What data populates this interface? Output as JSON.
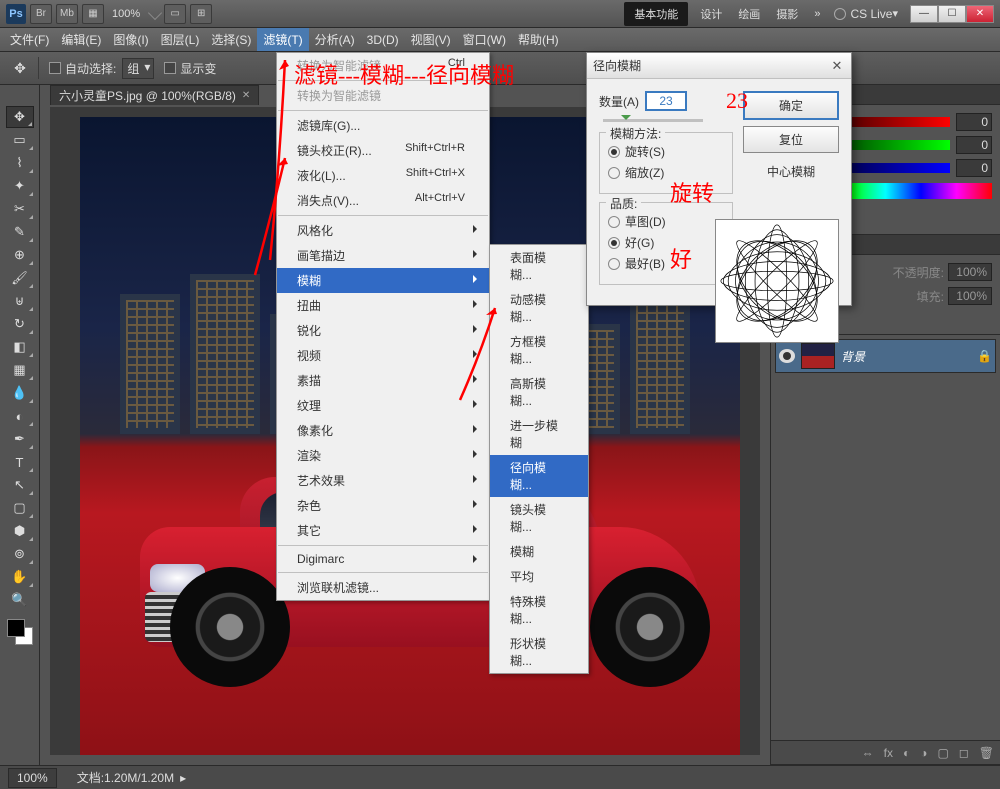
{
  "titlebar": {
    "zoom": "100%",
    "workspace_active": "基本功能",
    "workspace_items": [
      "设计",
      "绘画",
      "摄影"
    ],
    "more": "»",
    "cslive": "CS Live",
    "icons": [
      "Br",
      "Mb"
    ]
  },
  "menubar": {
    "items": [
      "文件(F)",
      "编辑(E)",
      "图像(I)",
      "图层(L)",
      "选择(S)",
      "滤镜(T)",
      "分析(A)",
      "3D(D)",
      "视图(V)",
      "窗口(W)",
      "帮助(H)"
    ],
    "active_index": 5
  },
  "optbar": {
    "auto_select": "自动选择:",
    "group": "组",
    "show_transform": "显示变"
  },
  "document": {
    "tab": "六小灵童PS.jpg @ 100%(RGB/8)",
    "status_zoom": "100%",
    "status_doc": "文档:1.20M/1.20M"
  },
  "filter_menu": {
    "last": "转换为智能滤镜",
    "last_shortcut": "Ctrl",
    "items1": [
      {
        "label": "滤镜库(G)...",
        "shortcut": ""
      },
      {
        "label": "镜头校正(R)...",
        "shortcut": "Shift+Ctrl+R"
      },
      {
        "label": "液化(L)...",
        "shortcut": "Shift+Ctrl+X"
      },
      {
        "label": "消失点(V)...",
        "shortcut": "Alt+Ctrl+V"
      }
    ],
    "items2": [
      "风格化",
      "画笔描边",
      "模糊",
      "扭曲",
      "锐化",
      "视频",
      "素描",
      "纹理",
      "像素化",
      "渲染",
      "艺术效果",
      "杂色",
      "其它"
    ],
    "hl_index": 2,
    "digimarc": "Digimarc",
    "browse": "浏览联机滤镜..."
  },
  "blur_submenu": {
    "items": [
      "表面模糊...",
      "动感模糊...",
      "方框模糊...",
      "高斯模糊...",
      "进一步模糊",
      "径向模糊...",
      "镜头模糊...",
      "模糊",
      "平均",
      "特殊模糊...",
      "形状模糊..."
    ],
    "hl_index": 5
  },
  "dialog": {
    "title": "径向模糊",
    "amount_label": "数量(A)",
    "amount_value": "23",
    "ok": "确定",
    "cancel": "复位",
    "method_legend": "模糊方法:",
    "method_spin": "旋转(S)",
    "method_zoom": "缩放(Z)",
    "quality_legend": "品质:",
    "quality_draft": "草图(D)",
    "quality_good": "好(G)",
    "quality_best": "最好(B)",
    "preview_label": "中心模糊"
  },
  "panels": {
    "color": {
      "r": "0",
      "g": "0",
      "b": "0"
    },
    "layers": {
      "opacity_label": "不透明度:",
      "opacity": "100%",
      "fill_label": "填充:",
      "fill": "100%",
      "layer_name": "背景"
    }
  },
  "annotations": {
    "path": "滤镜---模糊---径向模糊",
    "amount": "23",
    "spin": "旋转",
    "good": "好"
  }
}
